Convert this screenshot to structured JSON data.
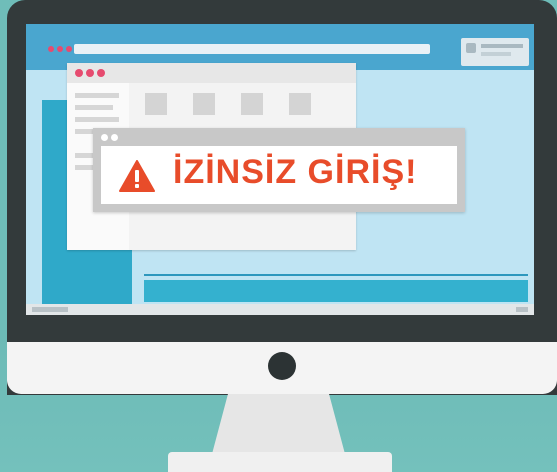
{
  "alert": {
    "title": "İZİNSİZ GİRİŞ!",
    "icon": "warning-triangle-icon"
  },
  "colors": {
    "background": "#6fbdb9",
    "monitor_bezel": "#333a3b",
    "screen": "#bfe4f3",
    "alert_red": "#e84c2a",
    "window_dots": "#e64b6f"
  }
}
